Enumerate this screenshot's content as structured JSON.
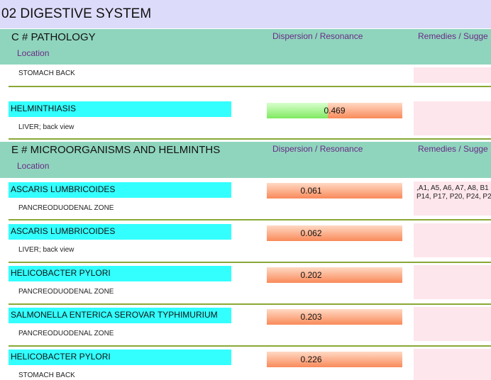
{
  "page_title": "02 DIGESTIVE SYSTEM",
  "sections": [
    {
      "title": "C # PATHOLOGY",
      "location_label": "Location",
      "dispersion_label": "Dispersion / Resonance",
      "remedies_label": "Remedies / Sugge"
    },
    {
      "title": "E # MICROORGANISMS AND HELMINTHS",
      "location_label": "Location",
      "dispersion_label": "Dispersion / Resonance",
      "remedies_label": "Remedies / Sugge"
    }
  ],
  "pathology_rows": [
    {
      "location": "STOMACH BACK"
    },
    {
      "name": "HELMINTHIASIS",
      "location": "LIVER; back view",
      "value": "0.469",
      "green_fraction": 0.45
    }
  ],
  "micro_rows": [
    {
      "name": "ASCARIS  LUMBRICOIDES",
      "location": "PANCREODUODENAL ZONE",
      "value": "0.061",
      "remedies": [
        ",A1, A5, A6, A7, A8, B1",
        "P14, P17, P20, P24, P2"
      ]
    },
    {
      "name": "ASCARIS  LUMBRICOIDES",
      "location": "LIVER; back view",
      "value": "0.062"
    },
    {
      "name": "HELICOBACTER PYLORI",
      "location": "PANCREODUODENAL ZONE",
      "value": "0.202"
    },
    {
      "name": "SALMONELLA ENTERICA SEROVAR TYPHIMURIUM",
      "location": "PANCREODUODENAL ZONE",
      "value": "0.203"
    },
    {
      "name": "HELICOBACTER PYLORI",
      "location": "STOMACH BACK",
      "value": "0.226"
    }
  ]
}
